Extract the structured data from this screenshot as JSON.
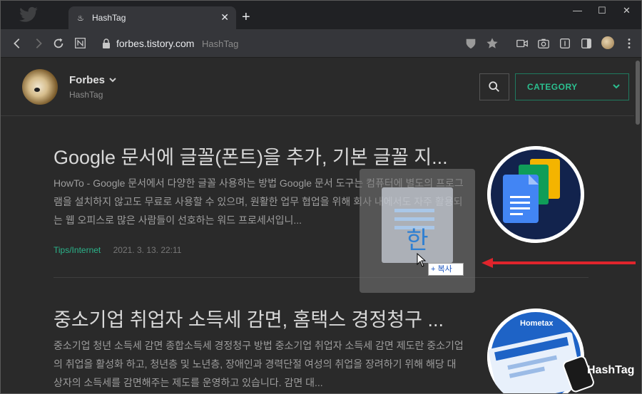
{
  "browser": {
    "tab_title": "HashTag",
    "tab_close": "✕",
    "new_tab": "+",
    "url_host": "forbes.tistory.com",
    "url_path": "HashTag",
    "window_controls": [
      "—",
      "☐",
      "✕"
    ]
  },
  "blog": {
    "name": "Forbes",
    "subtitle": "HashTag",
    "category_label": "CATEGORY"
  },
  "posts": [
    {
      "title": "Google 문서에 글꼴(폰트)을 추가, 기본 글꼴 지...",
      "excerpt": "HowTo - Google 문서에서 다양한 글꼴 사용하는 방법 Google 문서 도구는 컴퓨터에 별도의 프로그램을 설치하지 않고도 무료로 사용할 수 있으며, 원활한 업무 협업을 위해 회사 내에서도 자주 활용되는 웹 오피스로 많은 사람들이 선호하는 워드 프로세서입니...",
      "category": "Tips/Internet",
      "date": "2021. 3. 13. 22:11"
    },
    {
      "title": "중소기업 취업자 소득세 감면, 홈택스 경정청구 ...",
      "excerpt": "중소기업 청년 소득세 감면 종합소득세 경정청구 방법 중소기업 취업자 소득세 감면 제도란 중소기업의 취업을 활성화 하고, 청년층 및 노년층, 장애인과 경력단절 여성의 취업을 장려하기 위해 해당 대상자의 소득세를 감면해주는 제도를 운영하고 있습니다. 감면 대...",
      "category": "",
      "date": ""
    }
  ],
  "drag": {
    "copy_label": "+ 복사"
  },
  "thumb2_label": "Hometax",
  "watermark": "HashTag",
  "colors": {
    "accent": "#2bb38a",
    "arrow": "#e0242c"
  }
}
